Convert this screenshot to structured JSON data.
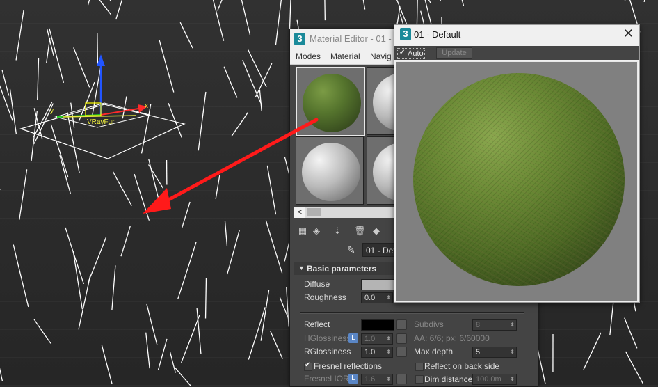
{
  "material_editor": {
    "title": "Material Editor - 01 -",
    "icon_label": "3",
    "menu": [
      "Modes",
      "Material",
      "Navig"
    ],
    "slot_materials": [
      "grass",
      "standard",
      "standard",
      "standard"
    ],
    "material_name": "01 - Def",
    "rollout_title": "Basic parameters",
    "params": {
      "diffuse_label": "Diffuse",
      "diffuse_color": "#b4b4b4",
      "roughness_label": "Roughness",
      "roughness_value": "0.0",
      "reflect_label": "Reflect",
      "reflect_color": "#000000",
      "subdivs_label": "Subdivs",
      "subdivs_value": "8",
      "hglossiness_label": "HGlossiness",
      "hglossiness_value": "1.0",
      "aa_text": "AA: 6/6; px: 6/60000",
      "rglossiness_label": "RGlossiness",
      "rglossiness_value": "1.0",
      "max_depth_label": "Max depth",
      "max_depth_value": "5",
      "fresnel_label": "Fresnel reflections",
      "fresnel_checked": true,
      "reflect_back_label": "Reflect on back side",
      "reflect_back_checked": false,
      "fresnel_ior_label": "Fresnel IOR",
      "fresnel_ior_value": "1.6",
      "dim_distance_label": "Dim distance",
      "dim_distance_checked": false,
      "dim_distance_value": "100.0m",
      "lock_label": "L"
    }
  },
  "preview": {
    "icon_label": "3",
    "title": "01 - Default",
    "close_label": "✕",
    "auto_label": "Auto",
    "auto_checked": true,
    "update_label": "Update"
  },
  "viewport": {
    "gizmo_label": "VRayFur",
    "axis_x": "x",
    "axis_y": "y",
    "arrow_color": "#ff1a1a"
  }
}
